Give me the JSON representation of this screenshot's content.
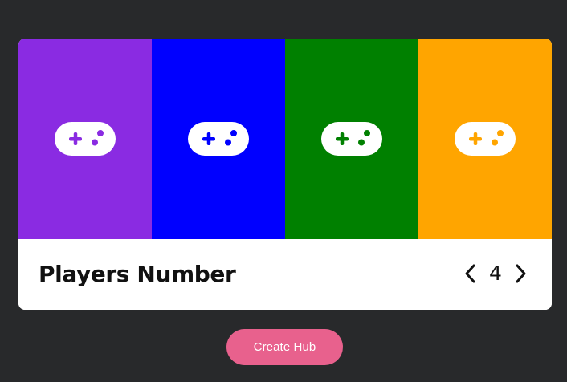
{
  "card": {
    "panels": [
      {
        "icon": "gamepad-icon",
        "color": "#8a2be2"
      },
      {
        "icon": "gamepad-icon",
        "color": "#0000ff"
      },
      {
        "icon": "gamepad-icon",
        "color": "#008000"
      },
      {
        "icon": "gamepad-icon",
        "color": "#ffa500"
      }
    ],
    "title": "Players Number",
    "count": "4",
    "prev_icon": "chevron-left-icon",
    "next_icon": "chevron-right-icon"
  },
  "create_button": {
    "label": "Create Hub",
    "color": "#e8618d"
  },
  "colors": {
    "background": "#28292b",
    "card": "#ffffff"
  }
}
